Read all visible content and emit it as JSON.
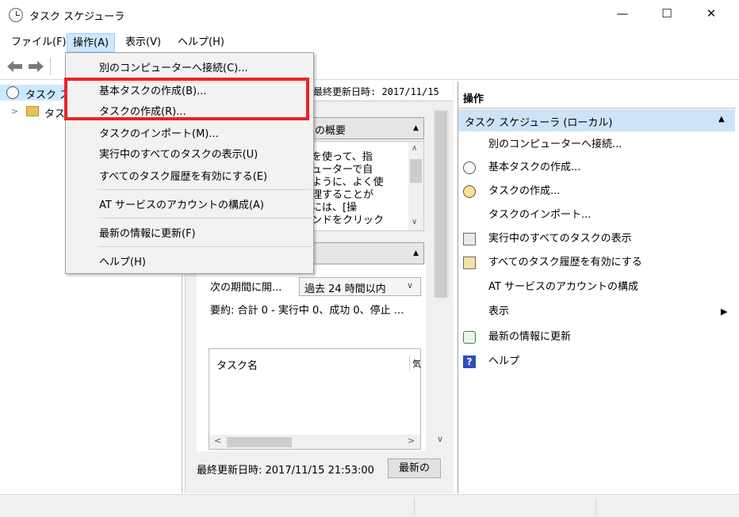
{
  "window": {
    "title": "タスク スケジューラ",
    "minimize": "—",
    "maximize": "☐",
    "close": "✕"
  },
  "menu": {
    "file": "ファイル(F)",
    "action": "操作(A)",
    "view": "表示(V)",
    "help": "ヘルプ(H)"
  },
  "dropdown": {
    "items": [
      "別のコンピューターへ接続(C)...",
      "基本タスクの作成(B)...",
      "タスクの作成(R)...",
      "タスクのインポート(M)...",
      "実行中のすべてのタスクの表示(U)",
      "すべてのタスク履歴を有効にする(E)",
      "AT サービスのアカウントの構成(A)",
      "最新の情報に更新(F)",
      "ヘルプ(H)"
    ]
  },
  "tree": {
    "root": "タスク ス",
    "child": "タス"
  },
  "center": {
    "header_updated": "最終更新日時: 2017/11/15",
    "overview_title": "の概要",
    "overview_lines": [
      "ーラを使って、指",
      "ンピューターで自",
      "れるように、よく使",
      "し管理することが",
      "するには、[操",
      "コマンドをクリック"
    ],
    "period_label": "次の期間に開...",
    "period_value": "過去 24 時間以内",
    "summary": "要約: 合計 0 - 実行中 0、成功 0、停止 ...",
    "task_col": "タスク名",
    "col2": "気",
    "footer_updated": "最終更新日時: 2017/11/15 21:53:00",
    "refresh_btn": "最新の"
  },
  "right": {
    "title": "操作",
    "section": "タスク スケジューラ (ローカル)",
    "actions": [
      {
        "label": "別のコンピューターへ接続...",
        "icon": "none"
      },
      {
        "label": "基本タスクの作成...",
        "icon": "clock-wizard-icon"
      },
      {
        "label": "タスクの作成...",
        "icon": "clock-new-icon"
      },
      {
        "label": "タスクのインポート...",
        "icon": "none"
      },
      {
        "label": "実行中のすべてのタスクの表示",
        "icon": "task-list-icon"
      },
      {
        "label": "すべてのタスク履歴を有効にする",
        "icon": "history-icon"
      },
      {
        "label": "AT サービスのアカウントの構成",
        "icon": "none"
      },
      {
        "label": "表示",
        "icon": "none"
      },
      {
        "label": "最新の情報に更新",
        "icon": "refresh-icon"
      },
      {
        "label": "ヘルプ",
        "icon": "help-icon"
      }
    ]
  },
  "colors": {
    "highlight": "#e8232a",
    "menu_active": "#cce8ff",
    "section_bg": "#cce4f7"
  }
}
